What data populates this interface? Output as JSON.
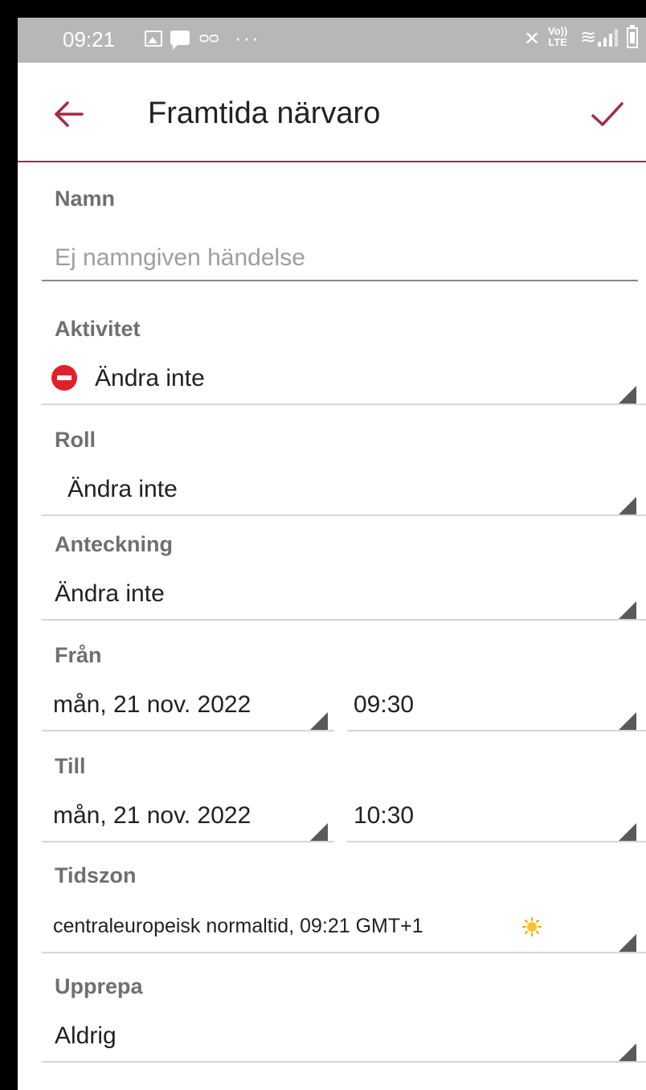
{
  "status_bar": {
    "time": "09:21",
    "voicemail_glyph": "ᴑᴑ",
    "more_glyph": "···",
    "mute_glyph": "✕",
    "lte_top": "Vo))",
    "lte_bottom": "LTE",
    "wifi_glyph": "≋",
    "icons": [
      "gallery-icon",
      "chat-icon",
      "voicemail-icon",
      "more-dots-icon",
      "mute-icon",
      "volte-icon",
      "wifi-icon",
      "signal-icon",
      "battery-icon"
    ]
  },
  "app_bar": {
    "title": "Framtida närvaro",
    "accent_color": "#a32b45",
    "back_icon": "arrow-left-icon",
    "save_icon": "checkmark-icon"
  },
  "form": {
    "name": {
      "label": "Namn",
      "value": "",
      "placeholder": "Ej namngiven händelse"
    },
    "activity": {
      "label": "Aktivitet",
      "value": "Ändra inte",
      "icon": "do-not-enter-icon",
      "icon_color": "#e2202a"
    },
    "role": {
      "label": "Roll",
      "value": "Ändra inte"
    },
    "note": {
      "label": "Anteckning",
      "value": "Ändra inte"
    },
    "from": {
      "label": "Från",
      "date": "mån, 21 nov. 2022",
      "time": "09:30"
    },
    "to": {
      "label": "Till",
      "date": "mån, 21 nov. 2022",
      "time": "10:30"
    },
    "timezone": {
      "label": "Tidszon",
      "value": "centraleuropeisk normaltid, 09:21  GMT+1",
      "icon": "sun-icon"
    },
    "repeat": {
      "label": "Upprepa",
      "value": "Aldrig"
    }
  }
}
